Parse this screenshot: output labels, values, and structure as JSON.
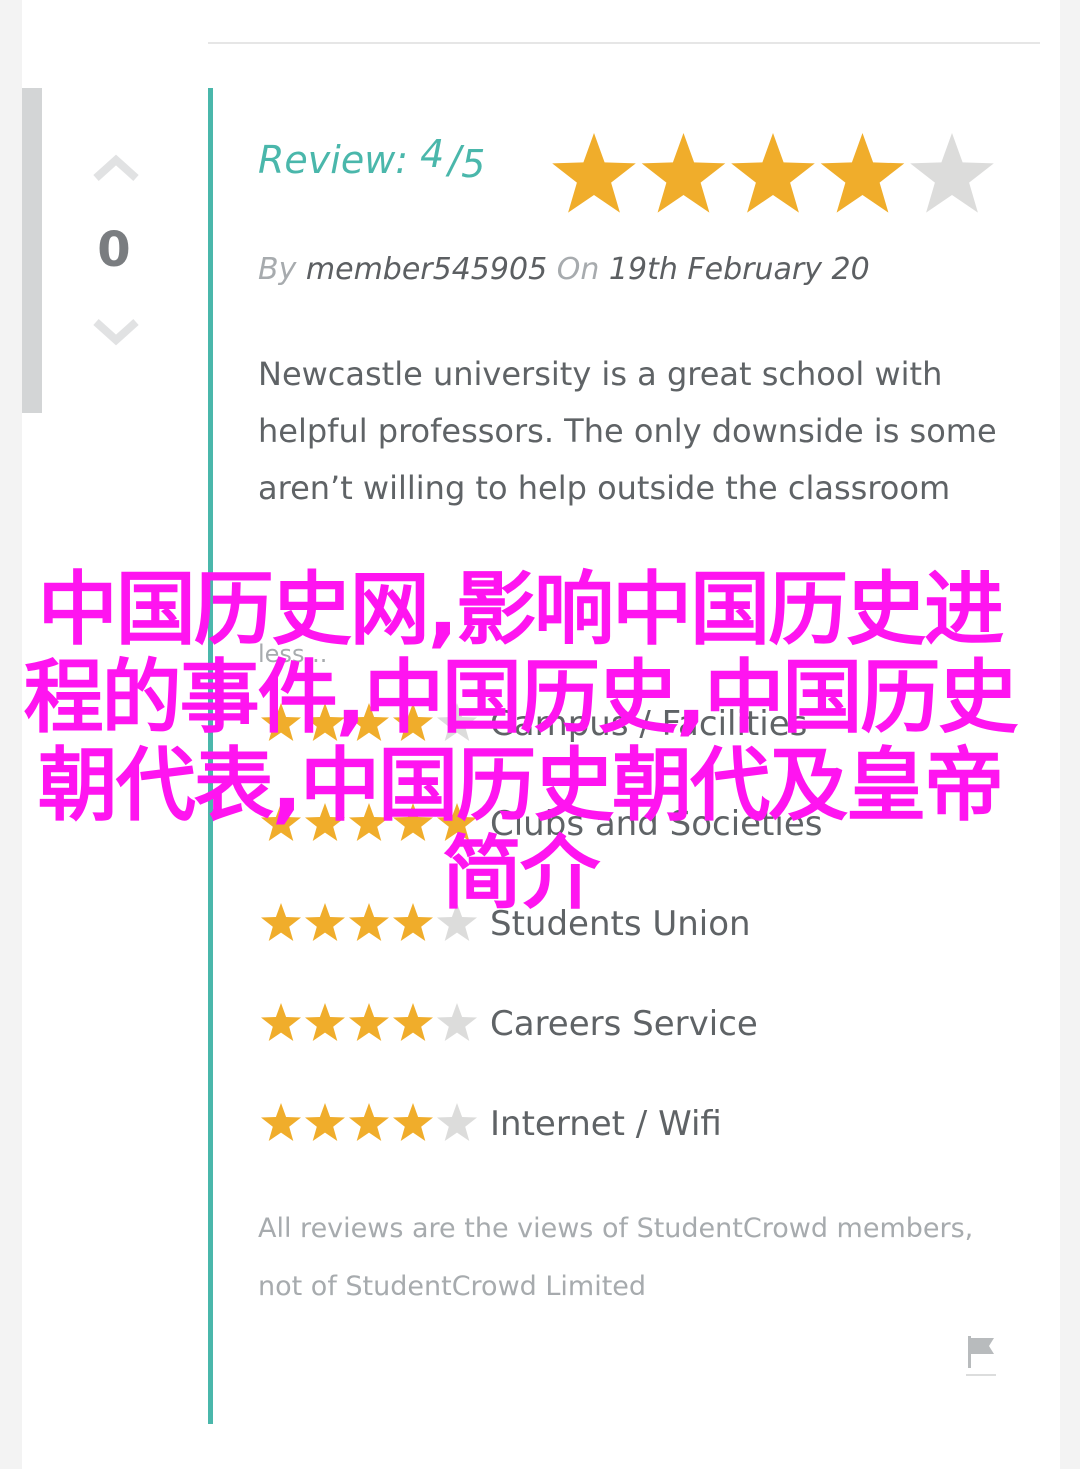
{
  "vote": {
    "count": "0",
    "up_icon": "chevron-up-icon",
    "down_icon": "chevron-down-icon"
  },
  "review": {
    "label": "Review:",
    "score": "4",
    "slash": "/",
    "out_of": "5",
    "rating": 4,
    "max_rating": 5,
    "by_prefix": "By",
    "author": "member545905",
    "on_prefix": "On",
    "date": "19th February 20",
    "text": "Newcastle university is a great school with helpful professors. The only downside is some aren’t willing to help outside the classroom",
    "less_link": "less..."
  },
  "categories": [
    {
      "label": "Campus / Facilities",
      "rating": 4
    },
    {
      "label": "Clubs and Societies",
      "rating": 5
    },
    {
      "label": "Students Union",
      "rating": 4
    },
    {
      "label": "Careers Service",
      "rating": 4
    },
    {
      "label": "Internet / Wifi",
      "rating": 4
    }
  ],
  "disclaimer": "All reviews are the views of StudentCrowd members, not of StudentCrowd Limited",
  "flag_icon": "flag-icon",
  "overlay_title": "中国历史网,影响中国历史进程的事件,中国历史,中国历史朝代表,中国历史朝代及皇帝简介",
  "colors": {
    "accent": "#4ab7ab",
    "star_filled": "#f0ad2b",
    "star_empty": "#dcdcdb",
    "overlay": "#ff14f0",
    "text": "#5f6366",
    "muted": "#a7abae"
  }
}
